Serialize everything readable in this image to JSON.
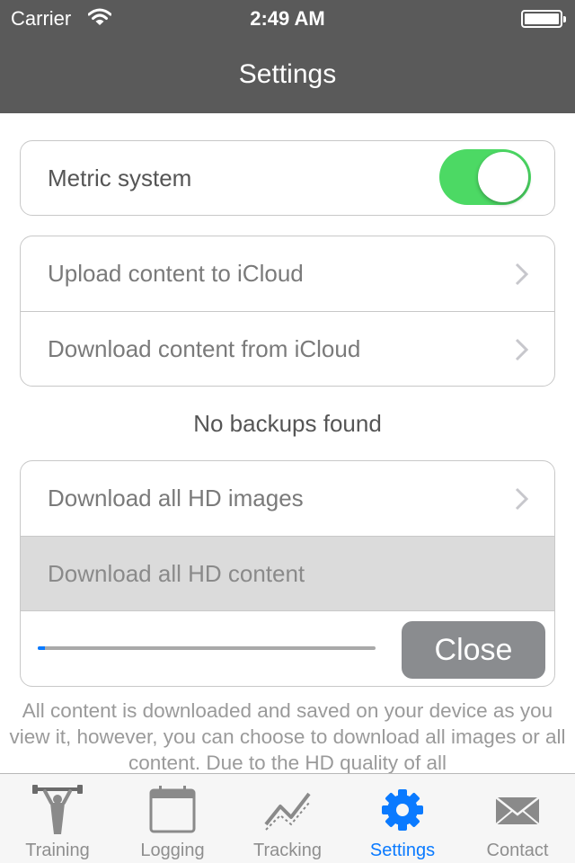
{
  "status_bar": {
    "carrier": "Carrier",
    "time": "2:49 AM",
    "wifi_icon": "wifi-icon",
    "battery_icon": "battery-icon",
    "battery_level": 1.0
  },
  "nav": {
    "title": "Settings"
  },
  "units_section": {
    "metric_label": "Metric system",
    "metric_enabled": true
  },
  "icloud_section": {
    "upload_label": "Upload content to iCloud",
    "download_label": "Download content from iCloud"
  },
  "backup_status": "No backups found",
  "hd_section": {
    "images_label": "Download all HD images",
    "content_label": "Download all HD content",
    "progress": 0.02,
    "close_label": "Close"
  },
  "note_text": "All content is downloaded and saved on your device as you view it, however, you can choose to download all images or all content. Due to the HD quality of all",
  "tabs": [
    {
      "label": "Training",
      "icon": "weightlifter-icon",
      "active": false
    },
    {
      "label": "Logging",
      "icon": "calendar-icon",
      "active": false
    },
    {
      "label": "Tracking",
      "icon": "chart-line-icon",
      "active": false
    },
    {
      "label": "Settings",
      "icon": "gear-icon",
      "active": true
    },
    {
      "label": "Contact",
      "icon": "envelope-icon",
      "active": false
    }
  ],
  "colors": {
    "nav_background": "#5a5a5a",
    "toggle_on": "#4cd964",
    "accent": "#0a7aff",
    "close_button": "#8a8c8f",
    "disabled_row": "#dbdbdb"
  }
}
